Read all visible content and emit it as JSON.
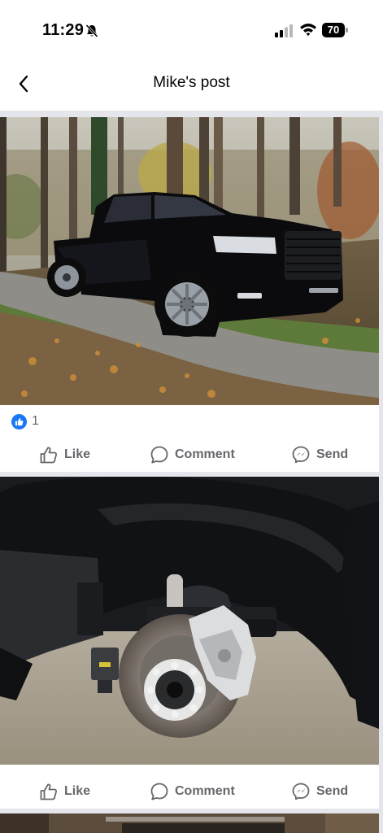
{
  "status_bar": {
    "time": "11:29",
    "battery": "70",
    "icons": [
      "bell-slash-icon",
      "cellular-signal-icon",
      "wifi-icon",
      "battery-icon"
    ]
  },
  "header": {
    "title": "Mike's post",
    "back_icon": "chevron-left-icon"
  },
  "posts": [
    {
      "photo": "black pickup truck parked on gravel driveway in autumn woods",
      "reactions": {
        "icon": "thumbs-up-icon",
        "count": "1"
      },
      "actions": {
        "like": "Like",
        "comment": "Comment",
        "send": "Send"
      }
    },
    {
      "photo": "truck wheel well with wheel removed showing brake rotor and caliper",
      "actions": {
        "like": "Like",
        "comment": "Comment",
        "send": "Send"
      }
    }
  ],
  "colors": {
    "accent": "#1877f2",
    "muted_text": "#65676b",
    "divider": "#e4e6eb"
  }
}
